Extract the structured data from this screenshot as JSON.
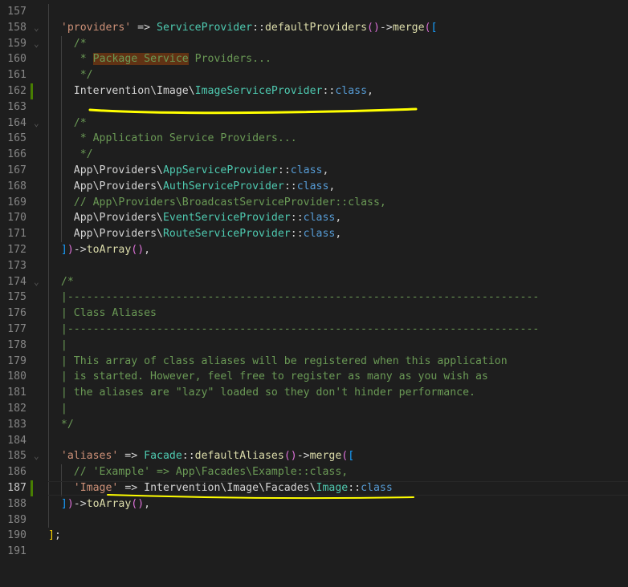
{
  "editor": {
    "first_line": 157,
    "active_line": 187,
    "modified_lines": [
      162,
      187
    ],
    "fold_lines": [
      158,
      159,
      164,
      174,
      185
    ],
    "colors": {
      "background": "#1e1e1e",
      "string": "#ce9178",
      "class": "#4ec9b0",
      "function": "#dcdcaa",
      "keyword": "#569cd6",
      "comment": "#6a9955",
      "annotation": "#ffff00"
    },
    "lines": [
      {
        "n": "157",
        "indent": 2,
        "tokens": []
      },
      {
        "n": "158",
        "indent": 2,
        "tokens": [
          [
            "str",
            "'providers'"
          ],
          [
            "op",
            " => "
          ],
          [
            "cls",
            "ServiceProvider"
          ],
          [
            "op",
            "::"
          ],
          [
            "fn",
            "defaultProviders"
          ],
          [
            "b2",
            "()"
          ],
          [
            "op",
            "->"
          ],
          [
            "fn",
            "merge"
          ],
          [
            "b2",
            "("
          ],
          [
            "b3",
            "["
          ]
        ]
      },
      {
        "n": "159",
        "indent": 4,
        "tokens": [
          [
            "com",
            "/*"
          ]
        ]
      },
      {
        "n": "160",
        "indent": 4,
        "tokens": [
          [
            "com",
            " * "
          ],
          [
            "hl",
            "Package Service"
          ],
          [
            "com",
            " Providers..."
          ]
        ]
      },
      {
        "n": "161",
        "indent": 4,
        "tokens": [
          [
            "com",
            " */"
          ]
        ]
      },
      {
        "n": "162",
        "indent": 4,
        "tokens": [
          [
            "txt",
            "Intervention\\Image\\"
          ],
          [
            "cls",
            "ImageServiceProvider"
          ],
          [
            "op",
            "::"
          ],
          [
            "kw",
            "class"
          ],
          [
            "op",
            ","
          ]
        ]
      },
      {
        "n": "163",
        "indent": 4,
        "tokens": []
      },
      {
        "n": "164",
        "indent": 4,
        "tokens": [
          [
            "com",
            "/*"
          ]
        ]
      },
      {
        "n": "165",
        "indent": 4,
        "tokens": [
          [
            "com",
            " * Application Service Providers..."
          ]
        ]
      },
      {
        "n": "166",
        "indent": 4,
        "tokens": [
          [
            "com",
            " */"
          ]
        ]
      },
      {
        "n": "167",
        "indent": 4,
        "tokens": [
          [
            "txt",
            "App\\Providers\\"
          ],
          [
            "cls",
            "AppServiceProvider"
          ],
          [
            "op",
            "::"
          ],
          [
            "kw",
            "class"
          ],
          [
            "op",
            ","
          ]
        ]
      },
      {
        "n": "168",
        "indent": 4,
        "tokens": [
          [
            "txt",
            "App\\Providers\\"
          ],
          [
            "cls",
            "AuthServiceProvider"
          ],
          [
            "op",
            "::"
          ],
          [
            "kw",
            "class"
          ],
          [
            "op",
            ","
          ]
        ]
      },
      {
        "n": "169",
        "indent": 4,
        "tokens": [
          [
            "com",
            "// App\\Providers\\BroadcastServiceProvider::class,"
          ]
        ]
      },
      {
        "n": "170",
        "indent": 4,
        "tokens": [
          [
            "txt",
            "App\\Providers\\"
          ],
          [
            "cls",
            "EventServiceProvider"
          ],
          [
            "op",
            "::"
          ],
          [
            "kw",
            "class"
          ],
          [
            "op",
            ","
          ]
        ]
      },
      {
        "n": "171",
        "indent": 4,
        "tokens": [
          [
            "txt",
            "App\\Providers\\"
          ],
          [
            "cls",
            "RouteServiceProvider"
          ],
          [
            "op",
            "::"
          ],
          [
            "kw",
            "class"
          ],
          [
            "op",
            ","
          ]
        ]
      },
      {
        "n": "172",
        "indent": 2,
        "tokens": [
          [
            "b3",
            "]"
          ],
          [
            "b2",
            ")"
          ],
          [
            "op",
            "->"
          ],
          [
            "fn",
            "toArray"
          ],
          [
            "b2",
            "()"
          ],
          [
            "op",
            ","
          ]
        ]
      },
      {
        "n": "173",
        "indent": 2,
        "tokens": []
      },
      {
        "n": "174",
        "indent": 2,
        "tokens": [
          [
            "com",
            "/*"
          ]
        ]
      },
      {
        "n": "175",
        "indent": 2,
        "tokens": [
          [
            "com",
            "|--------------------------------------------------------------------------"
          ]
        ]
      },
      {
        "n": "176",
        "indent": 2,
        "tokens": [
          [
            "com",
            "| Class Aliases"
          ]
        ]
      },
      {
        "n": "177",
        "indent": 2,
        "tokens": [
          [
            "com",
            "|--------------------------------------------------------------------------"
          ]
        ]
      },
      {
        "n": "178",
        "indent": 2,
        "tokens": [
          [
            "com",
            "|"
          ]
        ]
      },
      {
        "n": "179",
        "indent": 2,
        "tokens": [
          [
            "com",
            "| This array of class aliases will be registered when this application"
          ]
        ]
      },
      {
        "n": "180",
        "indent": 2,
        "tokens": [
          [
            "com",
            "| is started. However, feel free to register as many as you wish as"
          ]
        ]
      },
      {
        "n": "181",
        "indent": 2,
        "tokens": [
          [
            "com",
            "| the aliases are \"lazy\" loaded so they don't hinder performance."
          ]
        ]
      },
      {
        "n": "182",
        "indent": 2,
        "tokens": [
          [
            "com",
            "|"
          ]
        ]
      },
      {
        "n": "183",
        "indent": 2,
        "tokens": [
          [
            "com",
            "*/"
          ]
        ]
      },
      {
        "n": "184",
        "indent": 2,
        "tokens": []
      },
      {
        "n": "185",
        "indent": 2,
        "tokens": [
          [
            "str",
            "'aliases'"
          ],
          [
            "op",
            " => "
          ],
          [
            "cls",
            "Facade"
          ],
          [
            "op",
            "::"
          ],
          [
            "fn",
            "defaultAliases"
          ],
          [
            "b2",
            "()"
          ],
          [
            "op",
            "->"
          ],
          [
            "fn",
            "merge"
          ],
          [
            "b2",
            "("
          ],
          [
            "b3",
            "["
          ]
        ]
      },
      {
        "n": "186",
        "indent": 4,
        "tokens": [
          [
            "com",
            "// 'Example' => App\\Facades\\Example::class,"
          ]
        ]
      },
      {
        "n": "187",
        "indent": 4,
        "tokens": [
          [
            "str",
            "'Image'"
          ],
          [
            "op",
            " => "
          ],
          [
            "txt",
            "Intervention\\Image\\Facades\\"
          ],
          [
            "cls",
            "Image"
          ],
          [
            "op",
            "::"
          ],
          [
            "kw",
            "class"
          ]
        ]
      },
      {
        "n": "188",
        "indent": 2,
        "tokens": [
          [
            "b3",
            "]"
          ],
          [
            "b2",
            ")"
          ],
          [
            "op",
            "->"
          ],
          [
            "fn",
            "toArray"
          ],
          [
            "b2",
            "()"
          ],
          [
            "op",
            ","
          ]
        ]
      },
      {
        "n": "189",
        "indent": 2,
        "tokens": []
      },
      {
        "n": "190",
        "indent": 0,
        "tokens": [
          [
            "b1",
            "]"
          ],
          [
            "op",
            ";"
          ]
        ]
      },
      {
        "n": "191",
        "indent": 0,
        "tokens": []
      }
    ]
  }
}
